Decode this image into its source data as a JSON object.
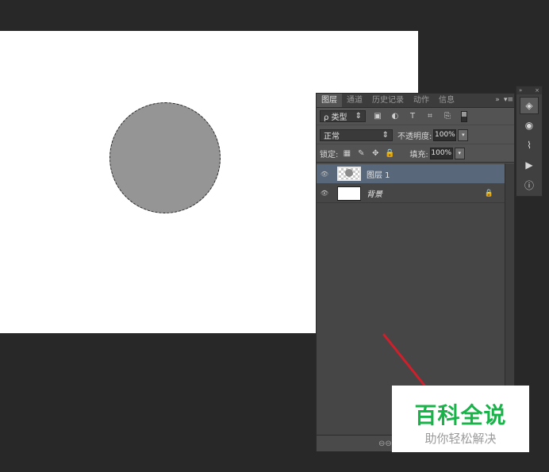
{
  "layers_panel": {
    "tabs": [
      "图层",
      "通道",
      "历史记录",
      "动作",
      "信息"
    ],
    "tab_overflow_glyph": "»",
    "tab_menu_glyph": "▾≡",
    "filter": {
      "label": "ρ 类型",
      "arrow": "⇕",
      "icons": [
        "▣",
        "◐",
        "T",
        "⌗",
        "⎘"
      ]
    },
    "blend_mode": {
      "value": "正常",
      "arrow": "⇕"
    },
    "opacity": {
      "label": "不透明度:",
      "value": "100%"
    },
    "lock": {
      "label": "锁定:",
      "icons": [
        "▦",
        "✎",
        "✥",
        "🔒"
      ]
    },
    "fill": {
      "label": "填充:",
      "value": "100%"
    },
    "dropdown_glyph": "▾",
    "layers": [
      {
        "name": "图层 1",
        "selected": true,
        "eye": "👁"
      },
      {
        "name": "背景",
        "selected": false,
        "eye": "👁",
        "locked": true
      }
    ],
    "bottom_link_glyph": "⊖⊖"
  },
  "side_strip": {
    "top_glyphs": [
      "»",
      "×"
    ],
    "icons": [
      "◈",
      "◉",
      "⌇",
      "▶",
      "ⓘ"
    ]
  },
  "watermark": {
    "title": "百科全说",
    "subtitle": "助你轻松解决"
  },
  "colors": {
    "canvas": "#ffffff",
    "circle": "#959595",
    "workspace": "#282828",
    "panel": "#535353",
    "selected_layer": "#586779",
    "accent_line": "#d01f2a",
    "watermark_green": "#19b34a"
  }
}
